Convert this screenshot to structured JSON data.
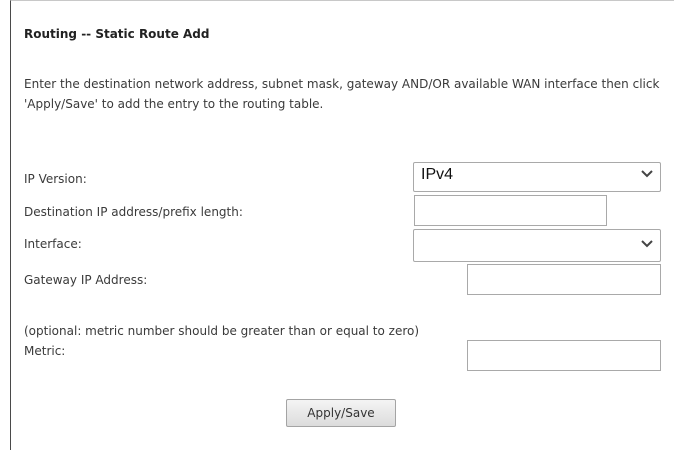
{
  "page": {
    "title": "Routing -- Static Route Add",
    "description": "Enter the destination network address, subnet mask, gateway AND/OR available WAN interface then click 'Apply/Save' to add the entry to the routing table."
  },
  "form": {
    "ip_version_label": "IP Version:",
    "ip_version_value": "IPv4",
    "destination_label": "Destination IP address/prefix length:",
    "destination_value": "",
    "interface_label": "Interface:",
    "interface_value": "",
    "gateway_label": "Gateway IP Address:",
    "gateway_value": "",
    "metric_note": "(optional: metric number should be greater than or equal to zero)",
    "metric_label": "Metric:",
    "metric_value": ""
  },
  "actions": {
    "apply_save_label": "Apply/Save"
  },
  "icons": {
    "dropdown": "chevron-down-icon"
  }
}
